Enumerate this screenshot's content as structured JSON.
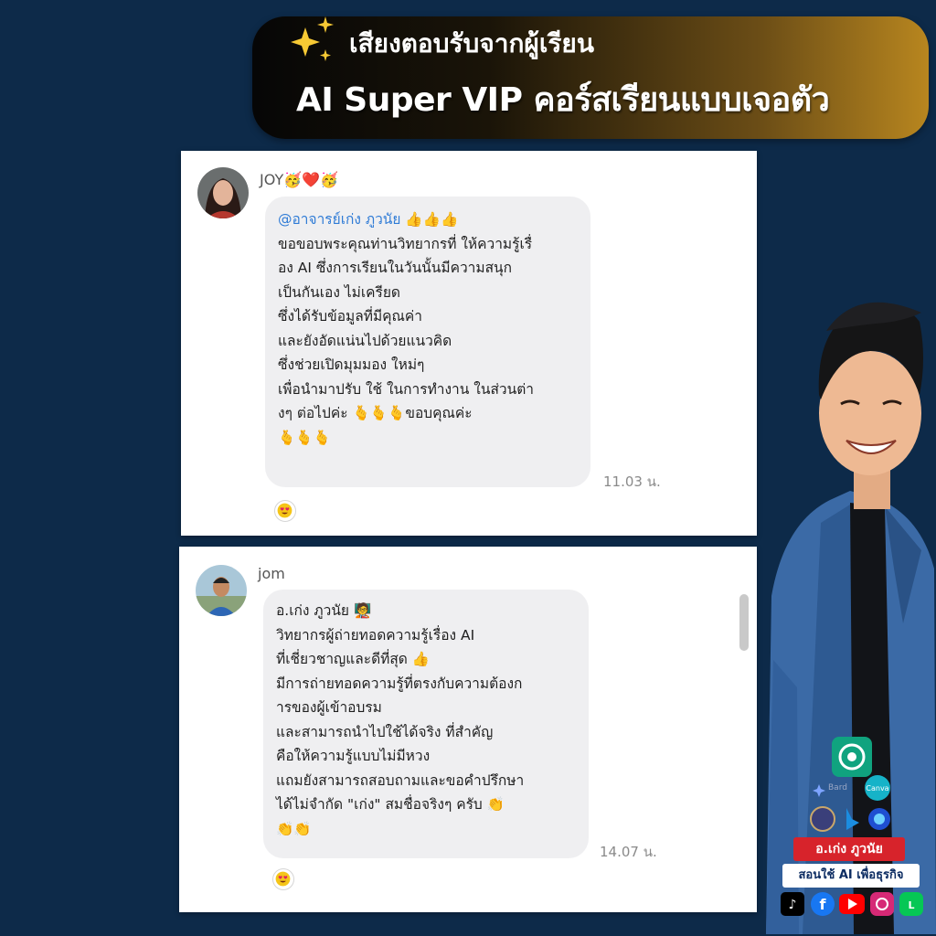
{
  "header": {
    "line1": "เสียงตอบรับจากผู้เรียน",
    "line2": "AI Super VIP คอร์สเรียนแบบเจอตัว"
  },
  "messages": [
    {
      "sender": "JOY🥳❤️🥳",
      "mention": "@อาจารย์เก่ง ภูวนัย",
      "mention_suffix": "👍👍👍",
      "lines": [
        "ขอขอบพระคุณท่านวิทยากรที่ ให้ความรู้เรื่",
        "อง AI  ซึ่งการเรียนในวันนั้นมีความสนุก",
        "เป็นกันเอง ไม่เครียด",
        "ซึ่งได้รับข้อมูลที่มีคุณค่า",
        "และยังอัดแน่นไปด้วยแนวคิด",
        "ซึ่งช่วยเปิดมุมมอง ใหม่ๆ",
        "เพื่อนำมาปรับ ใช้ ในการทำงาน ในส่วนต่า",
        "งๆ ต่อไปค่ะ  🫰🫰🫰ขอบคุณค่ะ",
        "🫰🫰🫰"
      ],
      "time": "11.03 น.",
      "reaction_icon": "heart-eyes-face-icon"
    },
    {
      "sender": "jom",
      "lines": [
        "อ.เก่ง ภูวนัย 🧑‍🏫",
        "วิทยากรผู้ถ่ายทอดความรู้เรื่อง AI",
        "ที่เชี่ยวชาญและดีที่สุด 👍",
        "มีการถ่ายทอดความรู้ที่ตรงกับความต้องก",
        "ารของผู้เข้าอบรม",
        "และสามารถนำไปใช้ได้จริง ที่สำคัญ",
        "คือให้ความรู้แบบไม่มีหวง",
        "แถมยังสามารถสอบถามและขอคำปรึกษา",
        "ได้ไม่จำกัด \"เก่ง\" สมชื่อจริงๆ ครับ 👏",
        "👏👏"
      ],
      "time": "14.07 น.",
      "reaction_icon": "heart-eyes-face-icon"
    }
  ],
  "presenter": {
    "name": "อ.เก่ง ภูวนัย",
    "tagline": "สอนใช้ AI เพื่อธุรกิจ",
    "tool_labels": [
      "Bard",
      "Canva"
    ],
    "social_icons": [
      "tiktok-icon",
      "facebook-icon",
      "youtube-icon",
      "instagram-icon",
      "line-icon"
    ]
  },
  "colors": {
    "background": "#0d2a49",
    "mention": "#2f7bd6",
    "name_tag": "#d7232b",
    "banner_gold": "#b8861f"
  }
}
